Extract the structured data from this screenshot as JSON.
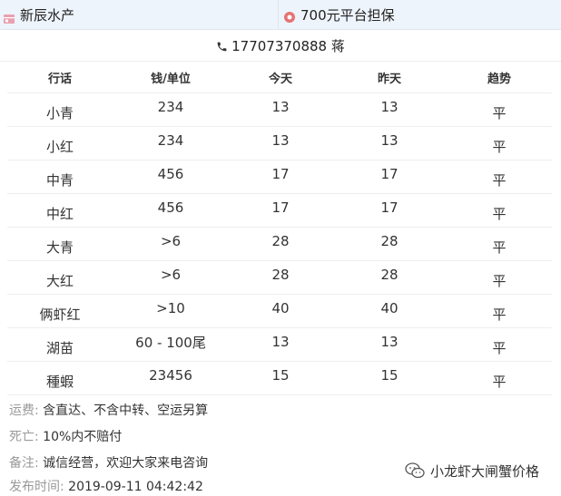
{
  "header": {
    "shop_name": "新辰水产",
    "guarantee": "700元平台担保"
  },
  "contact": {
    "phone_line": "17707370888 蒋"
  },
  "table": {
    "columns": [
      "行话",
      "钱/单位",
      "今天",
      "昨天",
      "趋势"
    ],
    "rows": [
      [
        "小青",
        "234",
        "13",
        "13",
        "平"
      ],
      [
        "小红",
        "234",
        "13",
        "13",
        "平"
      ],
      [
        "中青",
        "456",
        "17",
        "17",
        "平"
      ],
      [
        "中红",
        "456",
        "17",
        "17",
        "平"
      ],
      [
        "大青",
        ">6",
        "28",
        "28",
        "平"
      ],
      [
        "大红",
        ">6",
        "28",
        "28",
        "平"
      ],
      [
        "俩虾红",
        ">10",
        "40",
        "40",
        "平"
      ],
      [
        "湖苗",
        "60 - 100尾",
        "13",
        "13",
        "平"
      ],
      [
        "種蝦",
        "23456",
        "15",
        "15",
        "平"
      ]
    ]
  },
  "info": {
    "shipping_label": "运费:",
    "shipping_value": "含直达、不含中转、空运另算",
    "death_label": "死亡:",
    "death_value": "10%内不赔付",
    "note_label": "备注:",
    "note_value": "诚信经营，欢迎大家来电咨询",
    "published_label": "发布时间:",
    "published_value": "2019-09-11 04:42:42"
  },
  "watermark": {
    "text": "小龙虾大闸蟹价格"
  },
  "colors": {
    "topbar_bg": "#eef4fb",
    "shop_icon": "#e9a0b0",
    "guarantee_icon": "#e57373",
    "label_gray": "#999999"
  },
  "icons": {
    "shop": "shop-icon",
    "guarantee": "shield-icon",
    "phone": "phone-icon",
    "watermark": "wechat-icon"
  }
}
